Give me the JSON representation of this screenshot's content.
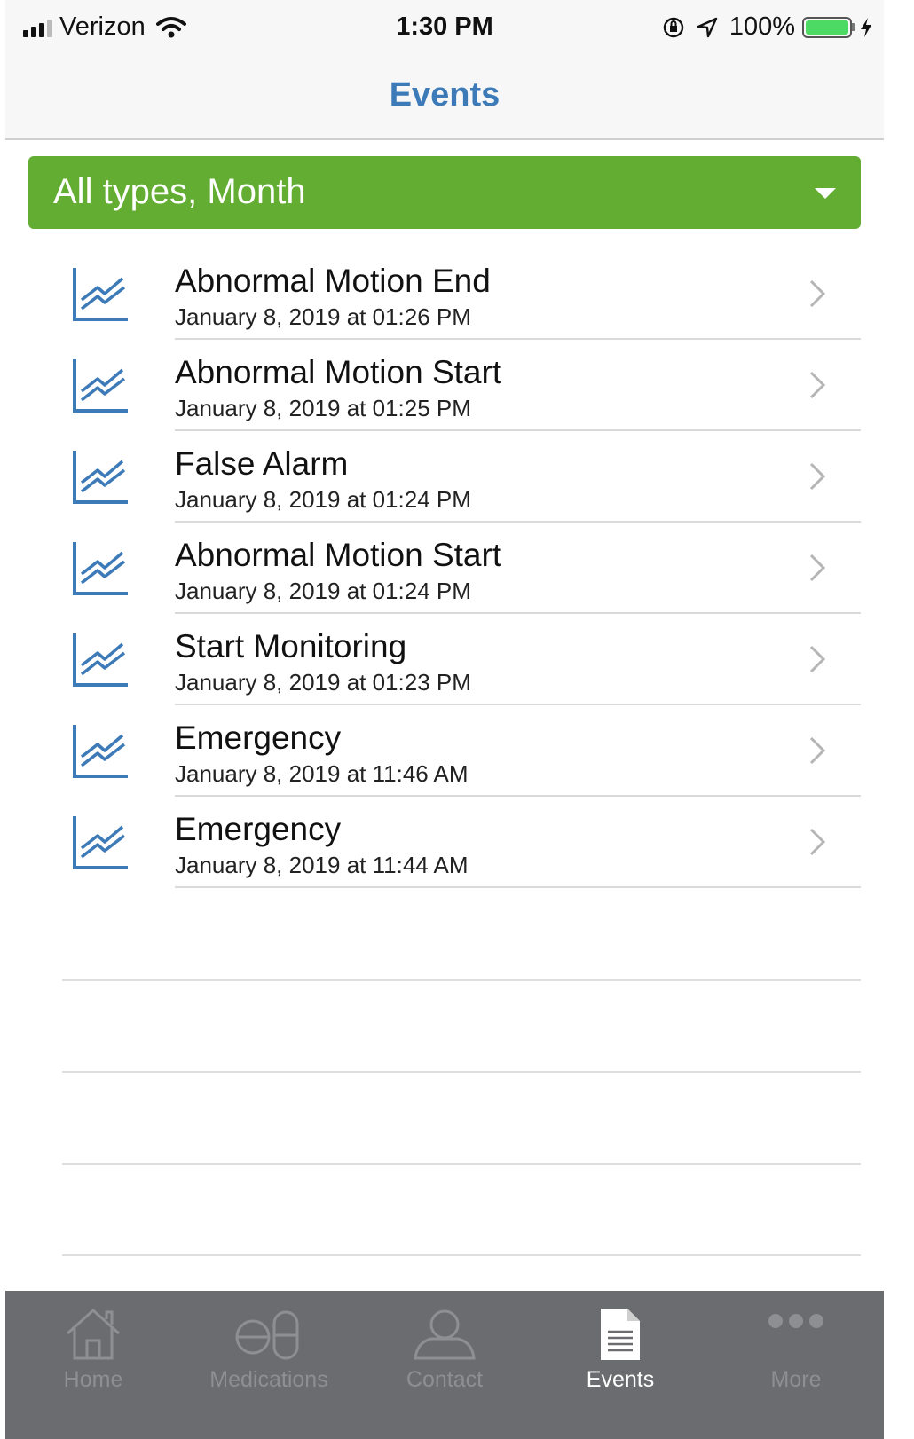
{
  "status_bar": {
    "carrier": "Verizon",
    "time": "1:30 PM",
    "battery_percent": "100%",
    "battery_level": 1.0,
    "battery_color": "#4cd964"
  },
  "nav": {
    "title": "Events",
    "title_color": "#3d7ab8"
  },
  "filter": {
    "label": "All types, Month",
    "background_color": "#62ad32"
  },
  "events": [
    {
      "title": "Abnormal Motion End",
      "date": "January 8, 2019 at 01:26 PM",
      "icon": "chart-line-icon"
    },
    {
      "title": "Abnormal Motion Start",
      "date": "January 8, 2019 at 01:25 PM",
      "icon": "chart-line-icon"
    },
    {
      "title": "False Alarm",
      "date": "January 8, 2019 at 01:24 PM",
      "icon": "chart-line-icon"
    },
    {
      "title": "Abnormal Motion Start",
      "date": "January 8, 2019 at 01:24 PM",
      "icon": "chart-line-icon"
    },
    {
      "title": "Start Monitoring",
      "date": "January 8, 2019 at 01:23 PM",
      "icon": "chart-line-icon"
    },
    {
      "title": "Emergency",
      "date": "January 8, 2019 at 11:46 AM",
      "icon": "chart-line-icon"
    },
    {
      "title": "Emergency",
      "date": "January 8, 2019 at 11:44 AM",
      "icon": "chart-line-icon"
    }
  ],
  "tab_bar": {
    "background_color": "#6b6c6f",
    "tabs": [
      {
        "label": "Home",
        "icon": "home-icon",
        "active": false
      },
      {
        "label": "Medications",
        "icon": "pill-icon",
        "active": false
      },
      {
        "label": "Contact",
        "icon": "person-icon",
        "active": false
      },
      {
        "label": "Events",
        "icon": "document-icon",
        "active": true
      },
      {
        "label": "More",
        "icon": "more-icon",
        "active": false
      }
    ]
  }
}
